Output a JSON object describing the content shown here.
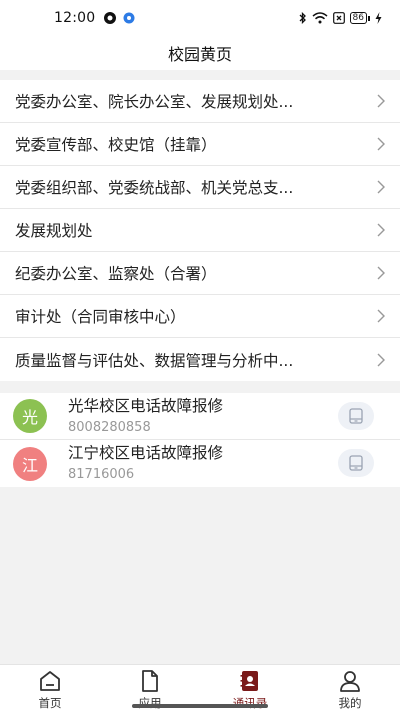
{
  "status_bar": {
    "time": "12:00",
    "battery": "86",
    "icons": [
      "notification-icon",
      "app-dot-icon",
      "bluetooth-icon",
      "wifi-icon",
      "sim-x-icon",
      "battery-icon",
      "charging-icon"
    ]
  },
  "header": {
    "title": "校园黄页"
  },
  "departments": [
    {
      "label": "党委办公室、院长办公室、发展规划处..."
    },
    {
      "label": "党委宣传部、校史馆（挂靠）"
    },
    {
      "label": "党委组织部、党委统战部、机关党总支..."
    },
    {
      "label": "发展规划处"
    },
    {
      "label": "纪委办公室、监察处（合署）"
    },
    {
      "label": "审计处（合同审核中心）"
    },
    {
      "label": "质量监督与评估处、数据管理与分析中..."
    }
  ],
  "contacts": [
    {
      "avatar": "光",
      "avatar_color": "#8cc152",
      "name": "光华校区电话故障报修",
      "phone": "8008280858"
    },
    {
      "avatar": "江",
      "avatar_color": "#f08080",
      "name": "江宁校区电话故障报修",
      "phone": "81716006"
    }
  ],
  "tabbar": {
    "tabs": [
      {
        "label": "首页",
        "icon": "home-icon"
      },
      {
        "label": "应用",
        "icon": "document-icon"
      },
      {
        "label": "通讯录",
        "icon": "contacts-book-icon",
        "active": true
      },
      {
        "label": "我的",
        "icon": "user-icon"
      }
    ]
  },
  "colors": {
    "accent": "#7a1a1a",
    "background": "#f2f2f2"
  }
}
